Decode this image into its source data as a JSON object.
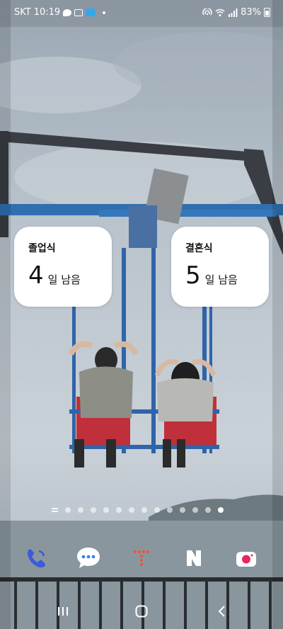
{
  "status_bar": {
    "carrier": "SKT",
    "time": "10:19",
    "battery": "83%",
    "left_icons": [
      "chat-icon",
      "gallery-icon",
      "app-notification-icon",
      "dot-icon"
    ],
    "right_icons": [
      "hotspot-icon",
      "wifi-icon",
      "signal-icon",
      "battery-charging-icon"
    ]
  },
  "widgets": [
    {
      "title": "졸업식",
      "count": "4",
      "suffix": "일 남음"
    },
    {
      "title": "결혼식",
      "count": "5",
      "suffix": "일 남음"
    }
  ],
  "page_indicator": {
    "total_pages": 13,
    "current_page": 13
  },
  "dock": {
    "apps": [
      {
        "name": "phone",
        "icon": "phone-icon",
        "color": "#ffffff",
        "accent": "#3b5bdb"
      },
      {
        "name": "messages",
        "icon": "message-icon",
        "color": "#2f80f0",
        "accent": "#ffffff"
      },
      {
        "name": "tmap",
        "icon": "t-icon",
        "color": "#ffffff",
        "accent": "#e8563b"
      },
      {
        "name": "naver",
        "icon": "naver-n-icon",
        "color": "#1ec800",
        "accent": "#ffffff"
      },
      {
        "name": "camera",
        "icon": "camera-icon",
        "color": "#e8285a",
        "accent": "#ffffff"
      }
    ]
  },
  "nav_bar": {
    "buttons": [
      "recents-icon",
      "home-icon",
      "back-icon"
    ]
  }
}
